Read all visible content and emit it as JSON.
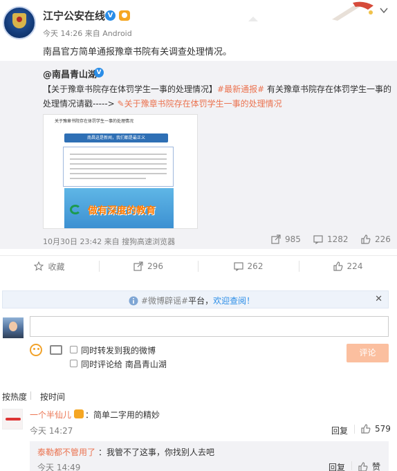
{
  "post": {
    "author": "江宁公安在线",
    "meta": "今天 14:26 来自 Android",
    "text": "南昌官方简单通报豫章书院有关调查处理情况。"
  },
  "repost": {
    "author": "@南昌青山湖",
    "line1_a": "【关于豫章书院存在体罚学生一事的处理情况】",
    "line1_hashtag": "#最新通报#",
    "line1_b": " 有关豫章书院存在体罚学生一事的",
    "line2_a": "处理情况请戳-----> ",
    "line2_link": "关于豫章书院存在体罚学生一事的处理情况",
    "thumb": {
      "title": "关于豫章书院存在体罚学生一事的处理情况",
      "bar_text": "南昌这是新闻，我们都是最正义",
      "banner_text": "做有深度的教育"
    },
    "footer_time": "10月30日 23:42 来自 搜狗高速浏览器",
    "forwards": "985",
    "comments": "1282",
    "likes": "226"
  },
  "actions": {
    "favorite": "收藏",
    "forward": "296",
    "comment": "262",
    "like": "224"
  },
  "notice": {
    "hashtag": "#微博辟谣#",
    "text": "平台，",
    "link": "欢迎查阅！"
  },
  "composer": {
    "placeholder": "",
    "opt1": "同时转发到我的微博",
    "opt2": "同时评论给 南昌青山湖",
    "submit": "评论"
  },
  "sort": {
    "hot": "按热度",
    "time": "按时间"
  },
  "comments": [
    {
      "name": "一个半仙儿",
      "text": "：简单二字用的精妙",
      "time": "今天 14:27",
      "reply": "回复",
      "likes": "579"
    }
  ],
  "nested": {
    "name": "泰勒都不管用了",
    "text": "：我管不了这事，你找别人去吧",
    "time": "今天 14:49",
    "reply": "回复",
    "like": "赞"
  },
  "icons": {
    "forward": "forward-icon",
    "comment": "comment-icon",
    "like": "thumbs-up-icon",
    "favorite": "star-icon"
  },
  "colors": {
    "accent": "#eb7350",
    "link": "#2a8de7",
    "muted": "#808080",
    "repost_bg": "#f2f2f5"
  }
}
